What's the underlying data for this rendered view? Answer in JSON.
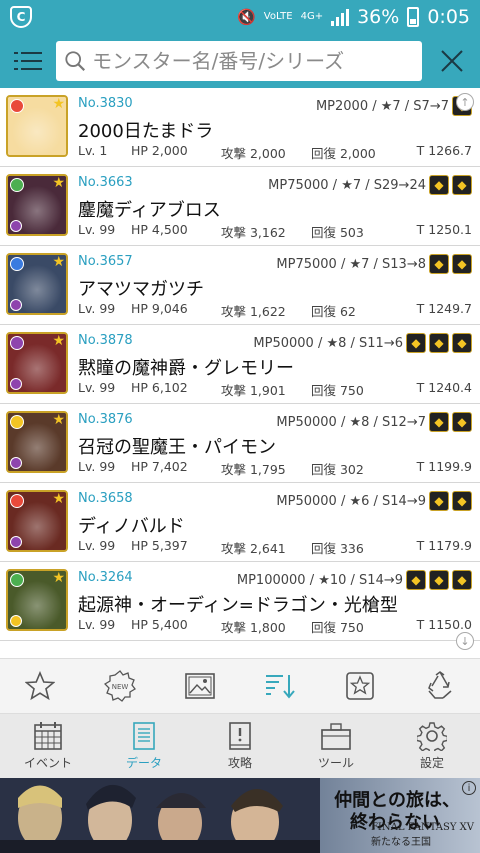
{
  "status_bar": {
    "network": "4G+",
    "volte": "VoLTE",
    "battery": "36%",
    "time": "0:05"
  },
  "search": {
    "placeholder": "モンスター名/番号/シリーズ",
    "value": ""
  },
  "monsters": [
    {
      "number": "No.3830",
      "name": "2000日たまドラ",
      "meta": "MP2000 / ★7 / S7→7",
      "lv": "Lv. 1",
      "hp": "HP 2,000",
      "atk": "攻撃 2,000",
      "rcv": "回復 2,000",
      "total": "T 1266.7",
      "art": "#f6dca0",
      "attr": "#e94a3a",
      "sub_attr": "",
      "awakening_icons": [
        "awakening-icon"
      ]
    },
    {
      "number": "No.3663",
      "name": "鏖魔ディアブロス",
      "meta": "MP75000 / ★7 / S29→24",
      "lv": "Lv. 99",
      "hp": "HP 4,500",
      "atk": "攻撃 3,162",
      "rcv": "回復 503",
      "total": "T 1250.1",
      "art": "#4a2a3a",
      "attr": "#4caf50",
      "sub_attr": "#8e44ad",
      "awakening_icons": [
        "awakening-icon",
        "awakening-icon"
      ]
    },
    {
      "number": "No.3657",
      "name": "アマツマガツチ",
      "meta": "MP75000 / ★7 / S13→8",
      "lv": "Lv. 99",
      "hp": "HP 9,046",
      "atk": "攻撃 1,622",
      "rcv": "回復 62",
      "total": "T 1249.7",
      "art": "#3a4a66",
      "attr": "#3a7be0",
      "sub_attr": "#8e44ad",
      "awakening_icons": [
        "awakening-icon",
        "awakening-icon"
      ]
    },
    {
      "number": "No.3878",
      "name": "黙瞳の魔神爵・グレモリー",
      "meta": "MP50000 / ★8 / S11→6",
      "lv": "Lv. 99",
      "hp": "HP 6,102",
      "atk": "攻撃 1,901",
      "rcv": "回復 750",
      "total": "T 1240.4",
      "art": "#7a2a2a",
      "attr": "#8e44ad",
      "sub_attr": "#8e44ad",
      "awakening_icons": [
        "awakening-icon",
        "awakening-icon",
        "awakening-icon"
      ]
    },
    {
      "number": "No.3876",
      "name": "召冠の聖魔王・パイモン",
      "meta": "MP50000 / ★8 / S12→7",
      "lv": "Lv. 99",
      "hp": "HP 7,402",
      "atk": "攻撃 1,795",
      "rcv": "回復 302",
      "total": "T 1199.9",
      "art": "#5a3a2a",
      "attr": "#f3c424",
      "sub_attr": "#8e44ad",
      "awakening_icons": [
        "awakening-icon",
        "awakening-icon"
      ]
    },
    {
      "number": "No.3658",
      "name": "ディノバルド",
      "meta": "MP50000 / ★6 / S14→9",
      "lv": "Lv. 99",
      "hp": "HP 5,397",
      "atk": "攻撃 2,641",
      "rcv": "回復 336",
      "total": "T 1179.9",
      "art": "#6a2a22",
      "attr": "#e94a3a",
      "sub_attr": "#8e44ad",
      "awakening_icons": [
        "awakening-icon",
        "awakening-icon"
      ]
    },
    {
      "number": "No.3264",
      "name": "起源神・オーディン=ドラゴン・光槍型",
      "meta": "MP100000 / ★10 / S14→9",
      "lv": "Lv. 99",
      "hp": "HP 5,400",
      "atk": "攻撃 1,800",
      "rcv": "回復 750",
      "total": "T 1150.0",
      "art": "#4a5a2a",
      "attr": "#4caf50",
      "sub_attr": "#f3c424",
      "awakening_icons": [
        "awakening-icon",
        "awakening-icon",
        "awakening-icon"
      ]
    }
  ],
  "toolbar": {
    "new_badge": "NEW"
  },
  "nav": [
    {
      "key": "events",
      "label": "イベント",
      "icon": "calendar-icon",
      "active": false
    },
    {
      "key": "data",
      "label": "データ",
      "icon": "list-icon",
      "active": true
    },
    {
      "key": "strategy",
      "label": "攻略",
      "icon": "book-icon",
      "active": false
    },
    {
      "key": "tools",
      "label": "ツール",
      "icon": "toolbox-icon",
      "active": false
    },
    {
      "key": "settings",
      "label": "設定",
      "icon": "gear-icon",
      "active": false
    }
  ],
  "ad": {
    "line1": "仲間との旅は、",
    "line2": "終わらない",
    "logo": "FINAL FANTASY XV",
    "logo_sub": "新たなる王国",
    "info": "i"
  },
  "colors": {
    "accent": "#37a8bc",
    "link": "#2a9fc0"
  }
}
